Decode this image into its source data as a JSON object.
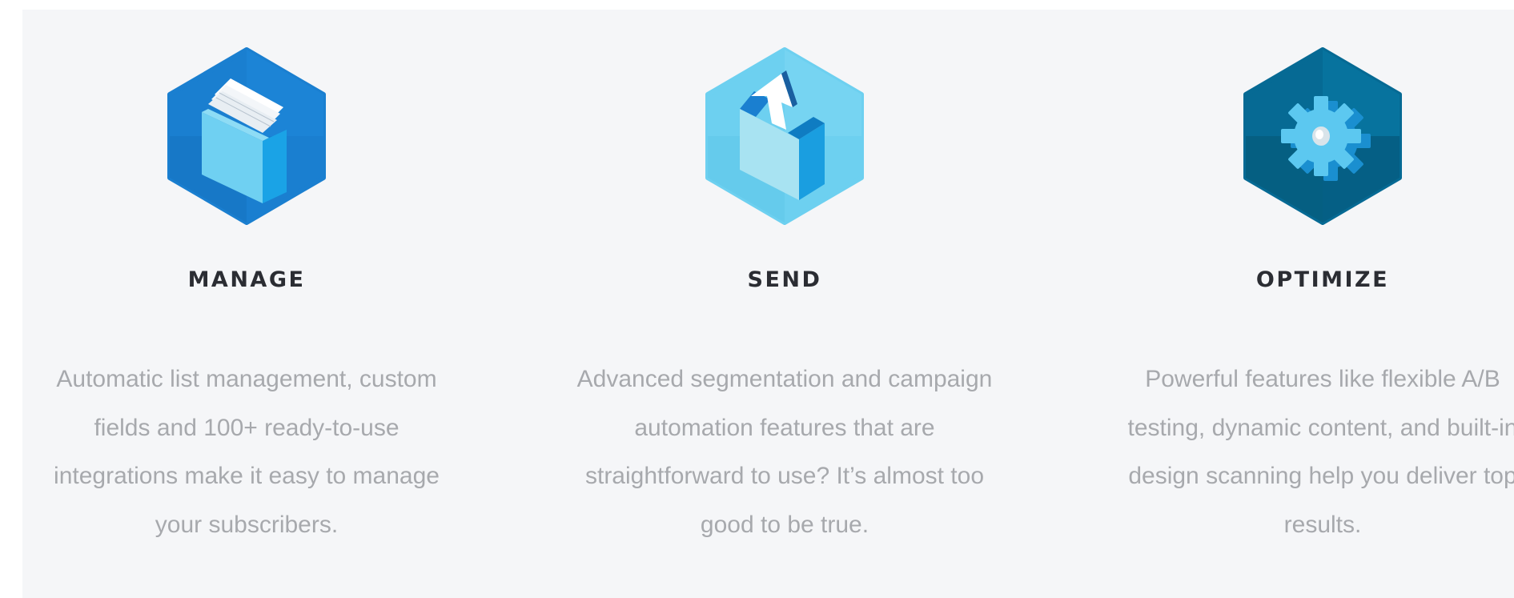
{
  "features": [
    {
      "title": "MANAGE",
      "description": "Automatic list management, custom fields and 100+ ready-to-use integrations make it easy to manage your subscribers.",
      "icon": "folder-icon",
      "color": "#1a7fd0"
    },
    {
      "title": "SEND",
      "description": "Advanced segmentation and campaign automation features that are straightforward to use? It’s almost too good to be true.",
      "icon": "send-box-icon",
      "color": "#6dd0f0"
    },
    {
      "title": "OPTIMIZE",
      "description": "Powerful features like flexible A/B testing, dynamic content, and built-in design scanning help you deliver top results.",
      "icon": "gear-icon",
      "color": "#066a94"
    }
  ]
}
